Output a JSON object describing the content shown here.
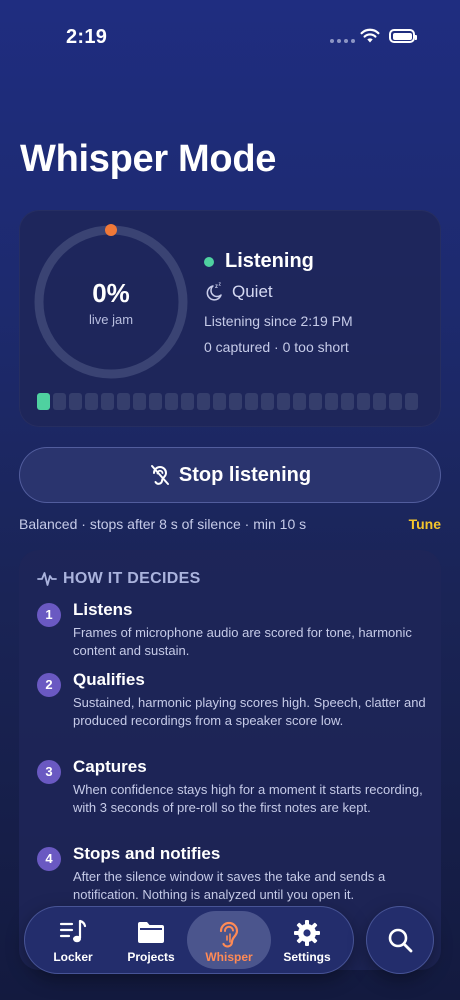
{
  "status_bar": {
    "time": "2:19"
  },
  "page": {
    "title": "Whisper Mode"
  },
  "status_card": {
    "ring_value": "0%",
    "ring_label": "live jam",
    "progress_fraction": 0.0,
    "state": "Listening",
    "ambience": "Quiet",
    "listening_since": "Listening since 2:19 PM",
    "counts": "0 captured · 0 too short",
    "level_meter": {
      "segments": 24,
      "active": 1
    }
  },
  "actions": {
    "stop_label": "Stop listening",
    "mode_summary": "Balanced · stops after 8 s of silence · min 10 s",
    "tune_label": "Tune"
  },
  "how_it_decides": {
    "heading": "HOW IT DECIDES",
    "steps": [
      {
        "num": "1",
        "title": "Listens",
        "desc": "Frames of microphone audio are scored for tone, harmonic content and sustain."
      },
      {
        "num": "2",
        "title": "Qualifies",
        "desc": "Sustained, harmonic playing scores high. Speech, clatter and produced recordings from a speaker score low."
      },
      {
        "num": "3",
        "title": "Captures",
        "desc": "When confidence stays high for a moment it starts recording, with 3 seconds of pre-roll so the first notes are kept."
      },
      {
        "num": "4",
        "title": "Stops and notifies",
        "desc": "After the silence window it saves the take and sends a notification. Nothing is analyzed until you open it."
      }
    ]
  },
  "tab_bar": {
    "tabs": [
      {
        "label": "Locker",
        "icon": "music-list-icon"
      },
      {
        "label": "Projects",
        "icon": "folder-icon"
      },
      {
        "label": "Whisper",
        "icon": "ear-icon",
        "active": true
      },
      {
        "label": "Settings",
        "icon": "gear-icon"
      }
    ],
    "search_icon": "search-icon"
  },
  "colors": {
    "listening": "#4fd1a0",
    "ring_indicator": "#f07838",
    "active_tab": "#ff8a55",
    "tune": "#f4c52c",
    "step_badge": "#6a59c2"
  }
}
